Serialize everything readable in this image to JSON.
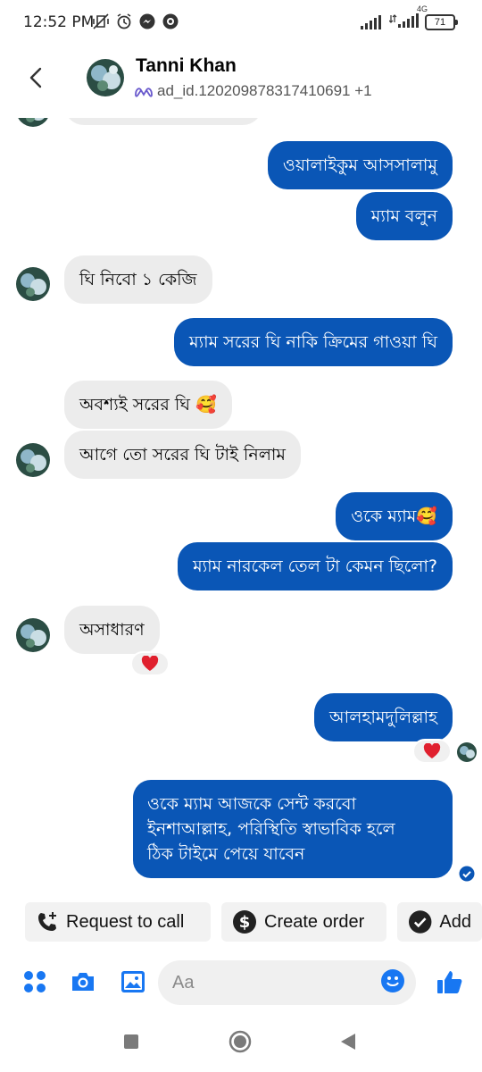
{
  "status_bar": {
    "time": "12:52 PM",
    "network": "4G",
    "battery": "71"
  },
  "header": {
    "name": "Tanni Khan",
    "subtitle": "ad_id.120209878317410691 +1"
  },
  "messages": [
    {
      "text": "ওয়ালাইকুম আসসালামু"
    },
    {
      "text": "ম্যাম বলুন"
    },
    {
      "text": "ঘি নিবো ১ কেজি"
    },
    {
      "text": "ম্যাম সরের ঘি নাকি ক্রিমের গাওয়া ঘি"
    },
    {
      "text": "অবশ্যই সরের ঘি 🥰"
    },
    {
      "text": "আগে তো সরের ঘি টাই নিলাম"
    },
    {
      "text": "ওকে ম্যাম🥰"
    },
    {
      "text": "ম্যাম নারকেল তেল টা কেমন ছিলো?"
    },
    {
      "text": "অসাধারণ"
    },
    {
      "text": "আলহামদুলিল্লাহ"
    },
    {
      "lines": [
        "ওকে ম্যাম আজকে সেন্ট করবো",
        "ইনশাআল্লাহ, পরিস্থিতি স্বাভাবিক হলে",
        "ঠিক টাইমে পেয়ে যাবেন"
      ]
    }
  ],
  "quick_actions": {
    "request_call": "Request to call",
    "create_order": "Create order",
    "add": "Add"
  },
  "composer": {
    "placeholder": "Aa"
  },
  "colors": {
    "accent": "#0a56b6",
    "incoming": "#ececec",
    "heart": "#e0202e",
    "messenger_blue": "#1877f2"
  }
}
